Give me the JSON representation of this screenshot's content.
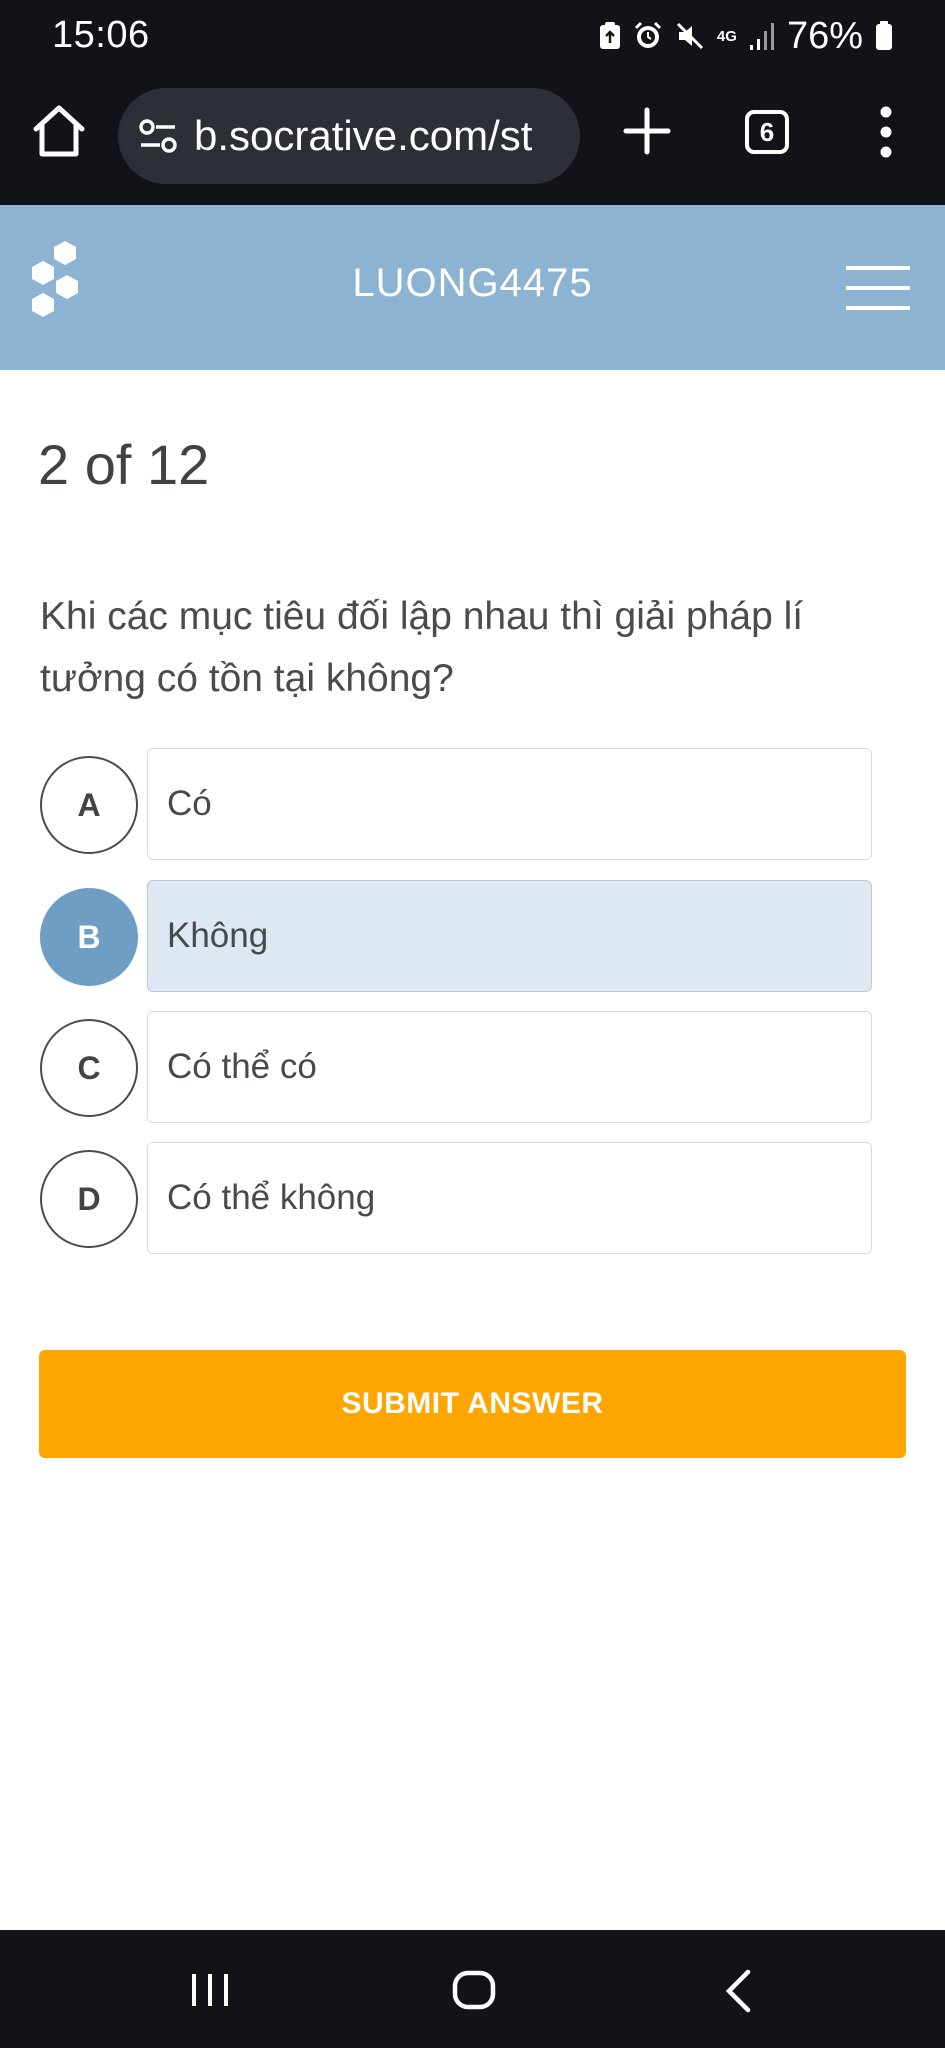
{
  "status_bar": {
    "time": "15:06",
    "network": "4G",
    "battery": "76%"
  },
  "browser": {
    "url": "b.socrative.com/st",
    "tab_count": "6"
  },
  "header": {
    "room_name": "LUONG4475"
  },
  "quiz": {
    "progress": "2 of 12",
    "question": "Khi các mục tiêu đối lập nhau thì giải pháp lí tưởng có tồn tại không?",
    "options": [
      {
        "letter": "A",
        "text": "Có"
      },
      {
        "letter": "B",
        "text": "Không"
      },
      {
        "letter": "C",
        "text": "Có thể có"
      },
      {
        "letter": "D",
        "text": "Có thể không"
      }
    ],
    "selected": "B",
    "submit_label": "SUBMIT ANSWER"
  },
  "colors": {
    "header_bg": "#8cb3d1",
    "selected_accent": "#6f9ec5",
    "selected_box": "#dde8f2",
    "submit_bg": "#ffa500",
    "system_bar": "#121318"
  },
  "icons": {
    "status": [
      "clipboard-icon",
      "alarm-icon",
      "mute-icon",
      "signal-icon",
      "battery-icon"
    ],
    "browser": [
      "home-icon",
      "site-settings-icon",
      "new-tab-icon",
      "tab-switcher-icon",
      "more-vert-icon"
    ],
    "app": [
      "socrative-logo",
      "hamburger-menu-icon"
    ],
    "nav": [
      "recents-icon",
      "home-nav-icon",
      "back-icon"
    ]
  }
}
